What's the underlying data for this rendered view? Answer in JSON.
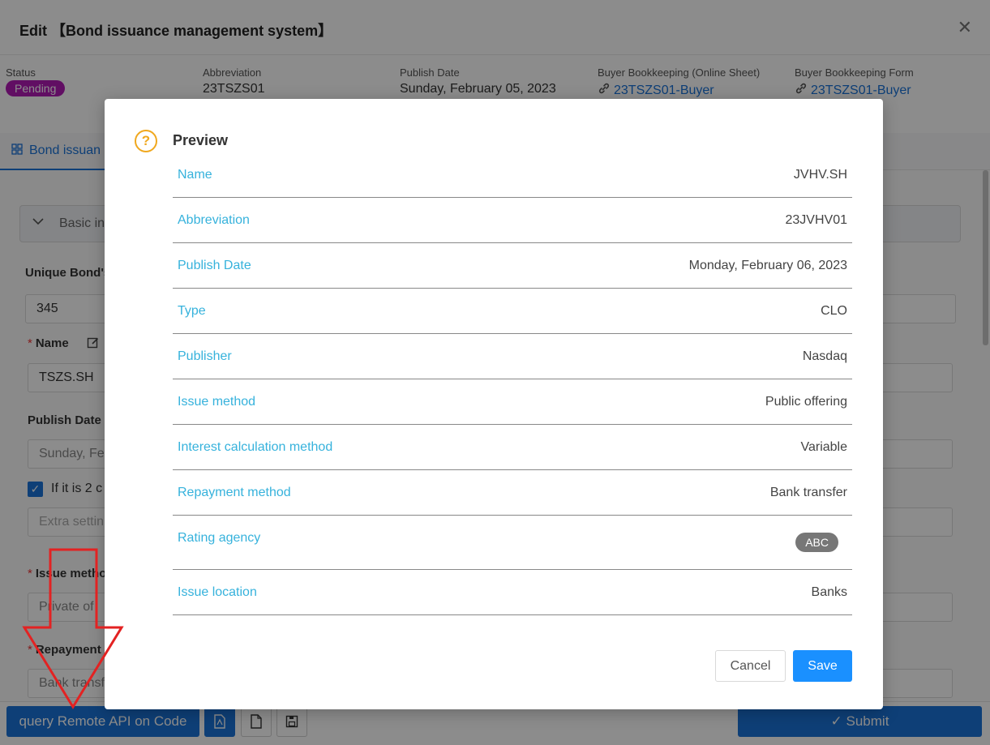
{
  "header": {
    "title": "Edit 【Bond issuance management system】",
    "close": "✕"
  },
  "info": {
    "status_label": "Status",
    "status_value": "Pending",
    "abbr_label": "Abbreviation",
    "abbr_value": "23TSZS01",
    "publish_label": "Publish Date",
    "publish_value": "Sunday, February 05, 2023",
    "online_sheet_label": "Buyer Bookkeeping (Online Sheet)",
    "online_sheet_link": "23TSZS01-Buyer",
    "form_label": "Buyer Bookkeeping Form",
    "form_link": "23TSZS01-Buyer"
  },
  "tabs": {
    "active": "Bond issuan"
  },
  "form": {
    "collapse_label": "Basic in",
    "unique_label": "Unique Bond's",
    "unique_value": "345",
    "name_label": "Name",
    "name_value": "TSZS.SH",
    "publish_label": "Publish Date",
    "publish_value": "Sunday, Fe",
    "check_label": "If it is 2 c",
    "extra_placeholder": "Extra settin",
    "issue_label": "Issue metho",
    "issue_value": "Private of",
    "repayment_label": "Repayment",
    "repayment_value": "Bank transf"
  },
  "footer": {
    "query_button": "query Remote API on Code",
    "submit_button": "✓  Submit"
  },
  "modal": {
    "icon": "?",
    "title": "Preview",
    "rows": [
      {
        "label": "Name",
        "value": "JVHV.SH"
      },
      {
        "label": "Abbreviation",
        "value": "23JVHV01"
      },
      {
        "label": "Publish Date",
        "value": "Monday, February 06, 2023"
      },
      {
        "label": "Type",
        "value": "CLO"
      },
      {
        "label": "Publisher",
        "value": "Nasdaq"
      },
      {
        "label": "Issue method",
        "value": "Public offering"
      },
      {
        "label": "Interest calculation method",
        "value": "Variable"
      },
      {
        "label": "Repayment method",
        "value": "Bank transfer"
      },
      {
        "label": "Rating agency",
        "value": "ABC"
      },
      {
        "label": "Issue location",
        "value": "Banks"
      }
    ],
    "cancel": "Cancel",
    "save": "Save"
  },
  "colors": {
    "accent": "#1a73d9",
    "label_blue": "#36b2dc",
    "status_purple": "#b11ab5",
    "warning": "#f0a81e",
    "annotation_red": "#e32222"
  }
}
